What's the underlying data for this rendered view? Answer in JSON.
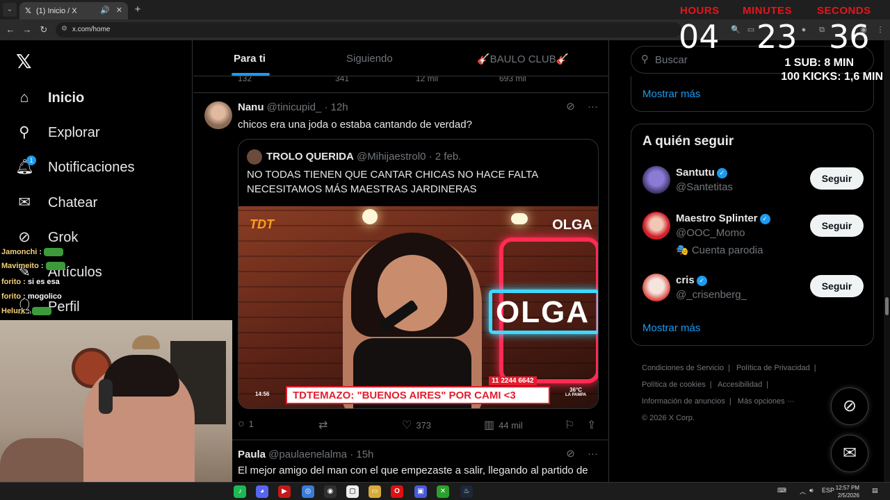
{
  "browser": {
    "tab_title": "(1) Inicio / X",
    "tab_logo": "𝕏",
    "url": "x.com/home",
    "icons": [
      "tab-search-icon",
      "audio-icon",
      "close-icon",
      "new-tab-icon",
      "back-icon",
      "forward-icon",
      "reload-icon",
      "site-settings-icon",
      "zoom-icon",
      "cast-icon",
      "extensions-icon",
      "profile-icon",
      "menu-icon"
    ]
  },
  "timer": {
    "labels": {
      "hours": "HOURS",
      "minutes": "MINUTES",
      "seconds": "SECONDS"
    },
    "hours": "04",
    "minutes": "23",
    "seconds": "36",
    "rule1": "1 SUB: 8 MIN",
    "rule2": "100 KICKS: 1,6 MIN",
    "label_color": "#e8141c"
  },
  "nav": {
    "logo": "𝕏",
    "items": [
      {
        "label": "Inicio",
        "icon": "home-icon"
      },
      {
        "label": "Explorar",
        "icon": "search-icon"
      },
      {
        "label": "Notificaciones",
        "icon": "bell-icon",
        "badge": "1"
      },
      {
        "label": "Chatear",
        "icon": "mail-icon"
      },
      {
        "label": "Grok",
        "icon": "grok-icon"
      },
      {
        "label": "Artículos",
        "icon": "article-icon"
      },
      {
        "label": "Perfil",
        "icon": "person-icon"
      }
    ]
  },
  "chat": [
    {
      "name": "Jamonchi",
      "msg": ""
    },
    {
      "name": "Mavimeito",
      "msg": ""
    },
    {
      "name": "forito",
      "msg": "si es esa"
    },
    {
      "name": "forito",
      "msg": "mogolico"
    },
    {
      "name": "Helurk",
      "msg": ""
    }
  ],
  "feed": {
    "tabs": [
      "Para ti",
      "Siguiendo",
      "🎸BAULO CLUB🎸"
    ],
    "prev_actions": {
      "replies": "132",
      "reposts": "341",
      "likes": "12 mil",
      "views": "693 mil"
    },
    "tweet1": {
      "name": "Nanu",
      "handle": "@tinicupid_",
      "time": "12h",
      "text": "chicos era una joda o estaba cantando de verdad?",
      "quote": {
        "name": "TROLO QUERIDA",
        "handle": "@Mihijaestrol0",
        "time": "2 feb.",
        "text": "NO TODAS TIENEN QUE CANTAR CHICAS NO HACE FALTA NECESITAMOS MÁS MAESTRAS JARDINERAS",
        "media": {
          "banner": "TDTEMAZO: \"BUENOS AIRES\" POR CAMI <3",
          "logo": "TDT",
          "corner": "OLGA",
          "neon": "OLGA",
          "time": "14:56",
          "phone": "11 2244 6642",
          "temp": "36°C",
          "place": "LA PAMPA"
        }
      },
      "actions": {
        "replies": "1",
        "reposts": "",
        "likes": "373",
        "views": "44 mil"
      }
    },
    "tweet2": {
      "name": "Paula",
      "handle": "@paulaenelalma",
      "time": "15h",
      "text": "El mejor amigo del man con el que empezaste a salir, llegando al partido de"
    }
  },
  "sidebar": {
    "search_placeholder": "Buscar",
    "show_more": "Mostrar más",
    "who_to_follow": {
      "title": "A quién seguir",
      "users": [
        {
          "name": "Santutu",
          "handle": "@Santetitas",
          "verified": true,
          "button": "Seguir"
        },
        {
          "name": "Maestro Splinter",
          "handle": "@OOC_Momo",
          "verified": true,
          "extra": "🎭 Cuenta parodia",
          "button": "Seguir"
        },
        {
          "name": "cris",
          "handle": "@_crisenberg_",
          "verified": true,
          "button": "Seguir"
        }
      ],
      "show_more": "Mostrar más"
    },
    "footer": {
      "links": [
        "Condiciones de Servicio",
        "Política de Privacidad",
        "Política de cookies",
        "Accesibilidad",
        "Información de anuncios",
        "Más opciones ···"
      ],
      "copyright": "© 2026 X Corp."
    }
  },
  "taskbar": {
    "apps": [
      "spotify",
      "discord",
      "video",
      "chrome",
      "obs",
      "app",
      "files",
      "opera",
      "app2",
      "xbox",
      "steam"
    ],
    "lang": "ESP",
    "time": "12:57 PM",
    "date": "2/5/2026"
  },
  "colors": {
    "accent": "#1d9bf0",
    "background": "#000000",
    "border": "#2f3336"
  }
}
